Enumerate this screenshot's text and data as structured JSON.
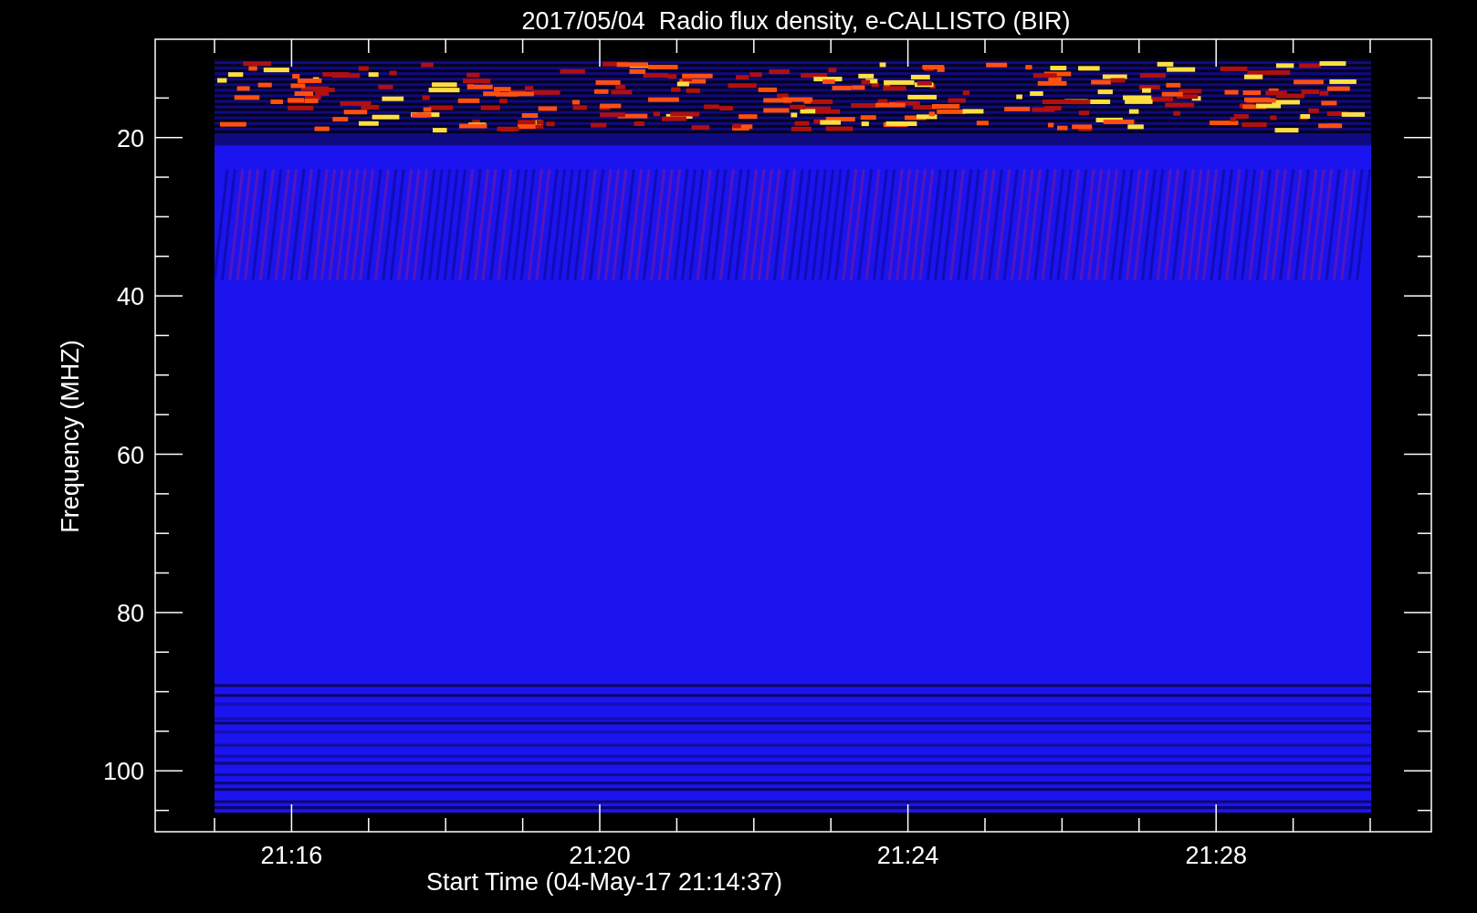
{
  "title": "2017/05/04  Radio flux density, e-CALLISTO (BIR)",
  "y_axis": {
    "label": "Frequency (MHZ)",
    "ticks": [
      "20",
      "40",
      "60",
      "80",
      "100"
    ]
  },
  "x_axis": {
    "label": "Start Time (04-May-17 21:14:37)",
    "ticks": [
      "21:16",
      "21:20",
      "21:24",
      "21:28"
    ]
  }
}
